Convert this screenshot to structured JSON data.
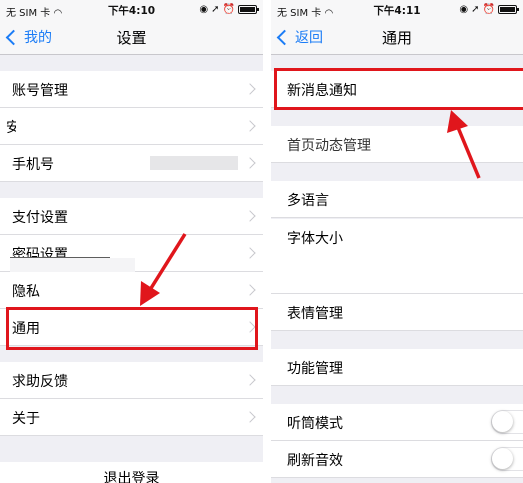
{
  "left": {
    "status": {
      "carrier": "无 SIM 卡",
      "time": "下午4:10"
    },
    "nav": {
      "back": "我的",
      "title": "设置"
    },
    "rows": [
      {
        "label": "账号管理"
      },
      {
        "label": "安"
      },
      {
        "label": "手机号"
      },
      {
        "label": "支付设置"
      },
      {
        "label": "密码设置"
      },
      {
        "label": "隐私"
      },
      {
        "label": "通用"
      },
      {
        "label": "求助反馈"
      },
      {
        "label": "关于"
      }
    ],
    "logout": "退出登录"
  },
  "right": {
    "status": {
      "carrier": "无 SIM 卡",
      "time": "下午4:11"
    },
    "nav": {
      "back": "返回",
      "title": "通用"
    },
    "rows": [
      {
        "label": "新消息通知"
      },
      {
        "label": "首页动态管理"
      },
      {
        "label": "多语言"
      },
      {
        "label": "字体大小"
      },
      {
        "label": "表情管理"
      },
      {
        "label": "功能管理"
      },
      {
        "label": "听筒模式",
        "toggle": false
      },
      {
        "label": "刷新音效",
        "toggle": false
      }
    ]
  },
  "colors": {
    "accent": "#1b7cf6",
    "highlight": "#e0161c",
    "background": "#efeff4"
  }
}
